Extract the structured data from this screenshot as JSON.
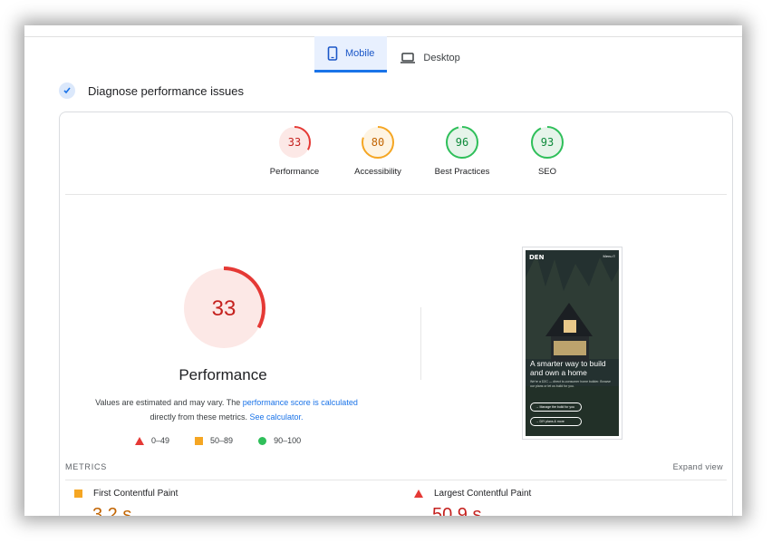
{
  "tabs": [
    {
      "label": "Mobile",
      "icon": "phone-icon",
      "active": true
    },
    {
      "label": "Desktop",
      "icon": "laptop-icon",
      "active": false
    }
  ],
  "diagnose": {
    "title": "Diagnose performance issues"
  },
  "gauges": [
    {
      "score": "33",
      "label": "Performance",
      "color": "#e53935",
      "bg": "#fce8e6",
      "fraction": 0.33
    },
    {
      "score": "80",
      "label": "Accessibility",
      "color": "#f5a623",
      "bg": "#fef4e3",
      "fraction": 0.8
    },
    {
      "score": "96",
      "label": "Best Practices",
      "color": "#2fbf5a",
      "bg": "#e6f4ea",
      "fraction": 0.96
    },
    {
      "score": "93",
      "label": "SEO",
      "color": "#2fbf5a",
      "bg": "#e6f4ea",
      "fraction": 0.93
    }
  ],
  "main": {
    "score": "33",
    "title": "Performance",
    "note_before": "Values are estimated and may vary. The ",
    "note_link1": "performance score is calculated",
    "note_mid": " directly from these metrics. ",
    "note_link2": "See calculator.",
    "legend": [
      {
        "range": "0–49",
        "shape": "triangle",
        "color": "#e53935"
      },
      {
        "range": "50–89",
        "shape": "square",
        "color": "#f5a623"
      },
      {
        "range": "90–100",
        "shape": "circle",
        "color": "#2fbf5a"
      }
    ]
  },
  "screenshot": {
    "logo": "DEN",
    "menu": "Menu ≡",
    "headline": "A smarter way to build and own a home",
    "body": "We're a D2C — direct to-consumer home builder. Browse our plans or let us build for you.",
    "button1": "→ Manage the build for you",
    "button2": "→ DIY plans & more"
  },
  "metrics": {
    "header": "METRICS",
    "expand": "Expand view",
    "items": [
      {
        "label": "First Contentful Paint",
        "value": "3.2 s",
        "shape": "square",
        "color": "#f5a623"
      },
      {
        "label": "Largest Contentful Paint",
        "value": "50.9 s",
        "shape": "triangle",
        "color": "#e53935"
      }
    ]
  }
}
